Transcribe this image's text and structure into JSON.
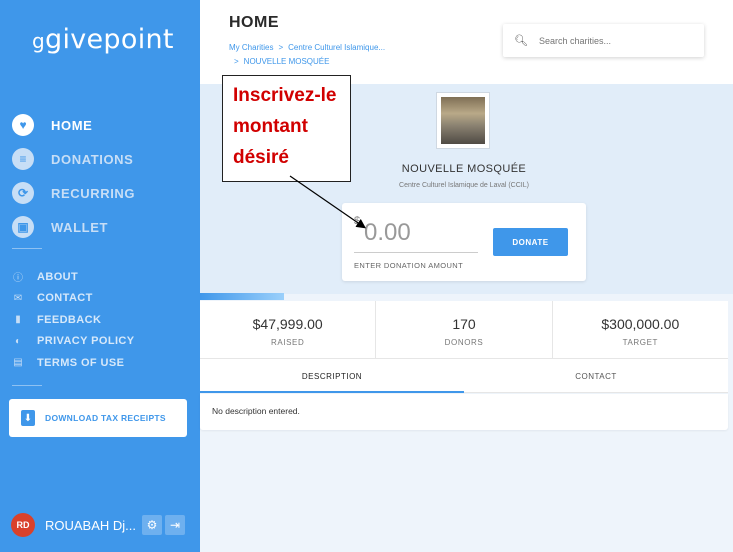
{
  "app": {
    "logo": "givepoint",
    "logo_mark": "g"
  },
  "sidebar": {
    "main_items": [
      {
        "label": "HOME",
        "icon": "heart-icon",
        "glyph": "♥"
      },
      {
        "label": "DONATIONS",
        "icon": "receipt-icon",
        "glyph": "≡"
      },
      {
        "label": "RECURRING",
        "icon": "refresh-icon",
        "glyph": "⟳"
      },
      {
        "label": "WALLET",
        "icon": "wallet-icon",
        "glyph": "▣"
      }
    ],
    "secondary_items": [
      {
        "label": "ABOUT",
        "icon": "info-icon",
        "glyph": "ⓘ"
      },
      {
        "label": "CONTACT",
        "icon": "envelope-icon",
        "glyph": "✉"
      },
      {
        "label": "FEEDBACK",
        "icon": "feedback-icon",
        "glyph": "▮"
      },
      {
        "label": "PRIVACY POLICY",
        "icon": "shield-icon",
        "glyph": "◐"
      },
      {
        "label": "TERMS OF USE",
        "icon": "document-icon",
        "glyph": "▤"
      }
    ],
    "tax_button": "DOWNLOAD TAX RECEIPTS",
    "user": {
      "initials": "RD",
      "name": "ROUABAH Dj..."
    }
  },
  "header": {
    "title": "HOME",
    "breadcrumb": [
      "My Charities",
      "Centre Culturel Islamique...",
      "NOUVELLE MOSQUÉE"
    ],
    "search_placeholder": "Search charities..."
  },
  "charity": {
    "name": "NOUVELLE MOSQUÉE",
    "organization": "Centre Culturel Islamique de Laval (CCIL)"
  },
  "donation": {
    "currency": "$",
    "amount": "0.00",
    "hint": "ENTER DONATION AMOUNT",
    "button": "DONATE"
  },
  "annotation": {
    "lines": [
      "Inscrivez-le",
      "montant",
      "désiré"
    ]
  },
  "stats": [
    {
      "value": "$47,999.00",
      "label": "RAISED"
    },
    {
      "value": "170",
      "label": "DONORS"
    },
    {
      "value": "$300,000.00",
      "label": "TARGET"
    }
  ],
  "tabs": [
    {
      "label": "DESCRIPTION",
      "active": true
    },
    {
      "label": "CONTACT",
      "active": false
    }
  ],
  "description": "No description entered.",
  "colors": {
    "primary": "#3f97ea",
    "annotation_text": "#d10000",
    "avatar": "#d9412b"
  }
}
